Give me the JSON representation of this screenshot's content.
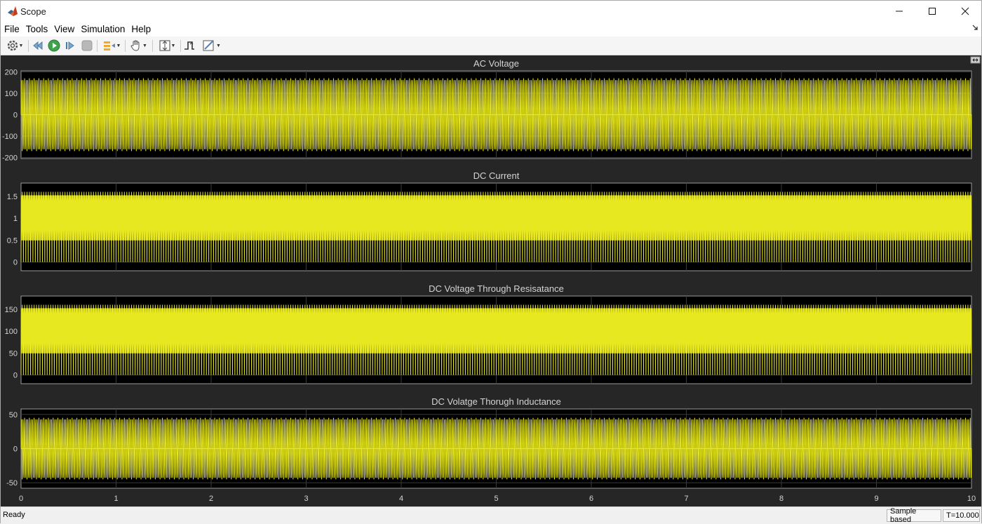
{
  "window": {
    "title": "Scope"
  },
  "menu": [
    "File",
    "Tools",
    "View",
    "Simulation",
    "Help"
  ],
  "toolbar": {
    "icons": [
      "settings-icon",
      "step-back-icon",
      "run-icon",
      "step-forward-icon",
      "stop-icon",
      "highlight-signal-icon",
      "pan-icon",
      "scale-axes-icon",
      "triggers-icon",
      "measurements-icon"
    ]
  },
  "status": {
    "ready": "Ready",
    "mode": "Sample based",
    "time": "T=10.000"
  },
  "colors": {
    "trace": "#e8e820",
    "background": "#262626",
    "axes_bg": "#000000",
    "grid": "#3a3a3a",
    "text": "#d4d4d4"
  },
  "chart_data": [
    {
      "type": "line",
      "title": "AC Voltage",
      "xlim": [
        0,
        10
      ],
      "ylim": [
        -205,
        205
      ],
      "yticks": [
        200,
        100,
        0,
        -100,
        -200
      ],
      "signal": {
        "kind": "sine",
        "amplitude": 170,
        "offset": 0,
        "cycles": 600
      }
    },
    {
      "type": "line",
      "title": "DC Current",
      "xlim": [
        0,
        10
      ],
      "ylim": [
        -0.2,
        1.8
      ],
      "yticks": [
        1.5,
        1,
        0.5,
        0
      ],
      "signal": {
        "kind": "rectified",
        "amplitude": 1.6,
        "offset": 0,
        "cycles": 600
      }
    },
    {
      "type": "line",
      "title": "DC Voltage Through Resisatance",
      "xlim": [
        0,
        10
      ],
      "ylim": [
        -20,
        180
      ],
      "yticks": [
        150,
        100,
        50,
        0
      ],
      "signal": {
        "kind": "rectified",
        "amplitude": 160,
        "offset": 0,
        "cycles": 600
      }
    },
    {
      "type": "line",
      "title": "DC Volatge Thorugh Inductance",
      "xlim": [
        0,
        10
      ],
      "ylim": [
        -58,
        58
      ],
      "yticks": [
        50,
        0,
        -50
      ],
      "signal": {
        "kind": "sine",
        "amplitude": 45,
        "offset": 0,
        "cycles": 600
      }
    }
  ],
  "xticks": [
    0,
    1,
    2,
    3,
    4,
    5,
    6,
    7,
    8,
    9,
    10
  ]
}
